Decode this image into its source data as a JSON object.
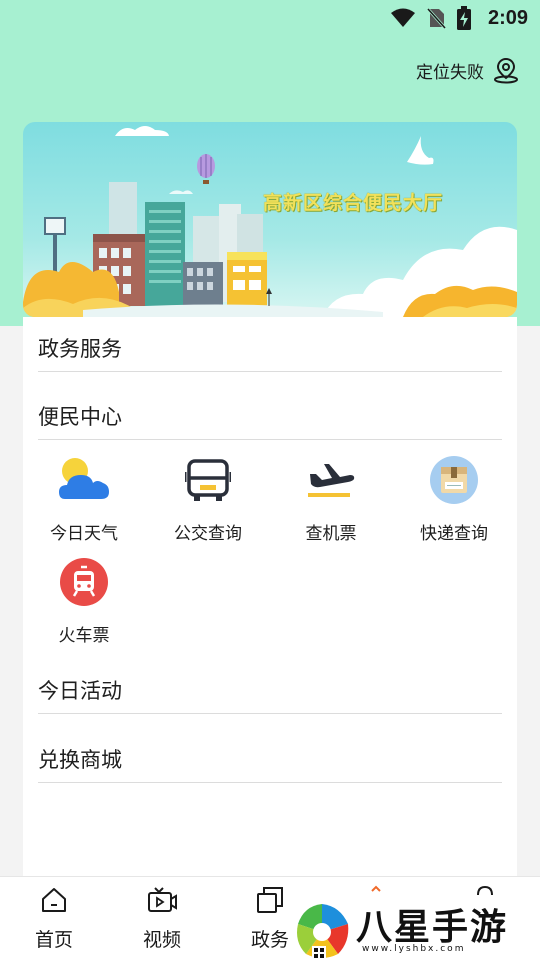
{
  "status_bar": {
    "time": "2:09"
  },
  "location": {
    "text": "定位失败"
  },
  "banner": {
    "title": "高新区综合便民大厅"
  },
  "sections": {
    "gov_service": "政务服务",
    "convenience_center": "便民中心",
    "today_activity": "今日活动",
    "exchange_mall": "兑换商城"
  },
  "convenience_items": [
    {
      "label": "今日天气",
      "icon": "weather-icon"
    },
    {
      "label": "公交查询",
      "icon": "bus-icon"
    },
    {
      "label": "查机票",
      "icon": "plane-icon"
    },
    {
      "label": "快递查询",
      "icon": "package-icon"
    },
    {
      "label": "火车票",
      "icon": "train-icon"
    }
  ],
  "bottom_nav": [
    {
      "label": "首页",
      "icon": "home-icon"
    },
    {
      "label": "视频",
      "icon": "video-icon"
    },
    {
      "label": "政务",
      "icon": "gov-icon"
    }
  ],
  "watermark": {
    "text": "八星手游网",
    "url": "www.lyshbx.com"
  },
  "colors": {
    "top_bg": "#a7f0d1",
    "banner_sky": "#7fdde0",
    "accent_red": "#e94b47"
  }
}
